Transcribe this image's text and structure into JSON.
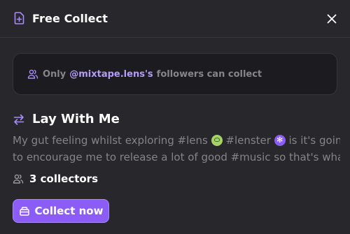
{
  "header": {
    "title": "Free Collect",
    "icon": "document-plus-icon",
    "close_icon": "close-icon"
  },
  "notice": {
    "icon": "users-icon",
    "prefix": "Only",
    "handle": "@mixtape.lens's",
    "suffix": "followers can collect"
  },
  "post": {
    "icon": "swap-arrows-icon",
    "title": "Lay With Me",
    "text_part1": "My gut feeling whilst exploring #lens ",
    "text_part2": " #lenster ",
    "text_part3": " is it's going",
    "text_line2": "to encourage me to release a lot of good #music so that's what...",
    "emojis": [
      "lens-emoji",
      "lenster-emoji"
    ]
  },
  "collectors": {
    "icon": "users-icon",
    "label": "3 collectors"
  },
  "collect_button": {
    "icon": "collect-icon",
    "label": "Collect now"
  },
  "colors": {
    "accent": "#8b5cf6",
    "handle": "#b39df5",
    "background": "#28272b",
    "muted_text": "#85848a"
  }
}
